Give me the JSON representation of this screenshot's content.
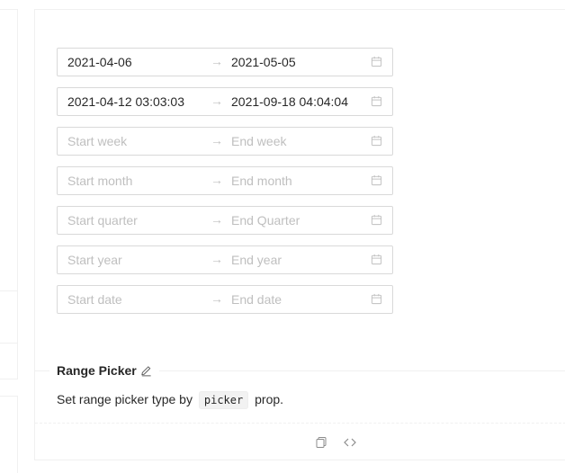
{
  "pickers": [
    {
      "start": "2021-04-06",
      "end": "2021-05-05",
      "start_placeholder": "",
      "end_placeholder": ""
    },
    {
      "start": "2021-04-12 03:03:03",
      "end": "2021-09-18 04:04:04",
      "start_placeholder": "",
      "end_placeholder": ""
    },
    {
      "start": "",
      "end": "",
      "start_placeholder": "Start week",
      "end_placeholder": "End week"
    },
    {
      "start": "",
      "end": "",
      "start_placeholder": "Start month",
      "end_placeholder": "End month"
    },
    {
      "start": "",
      "end": "",
      "start_placeholder": "Start quarter",
      "end_placeholder": "End Quarter"
    },
    {
      "start": "",
      "end": "",
      "start_placeholder": "Start year",
      "end_placeholder": "End year"
    },
    {
      "start": "",
      "end": "",
      "start_placeholder": "Start date",
      "end_placeholder": "End date"
    }
  ],
  "separator": "→",
  "meta": {
    "title": "Range Picker",
    "desc_before": "Set range picker type by",
    "desc_code": "picker",
    "desc_after": "prop."
  },
  "icons": {
    "calendar": "calendar-icon",
    "edit": "edit-icon",
    "copy": "copy-icon",
    "code": "code-icon"
  },
  "colors": {
    "border": "#d9d9d9",
    "placeholder": "#bfbfbf",
    "text": "#262626"
  }
}
